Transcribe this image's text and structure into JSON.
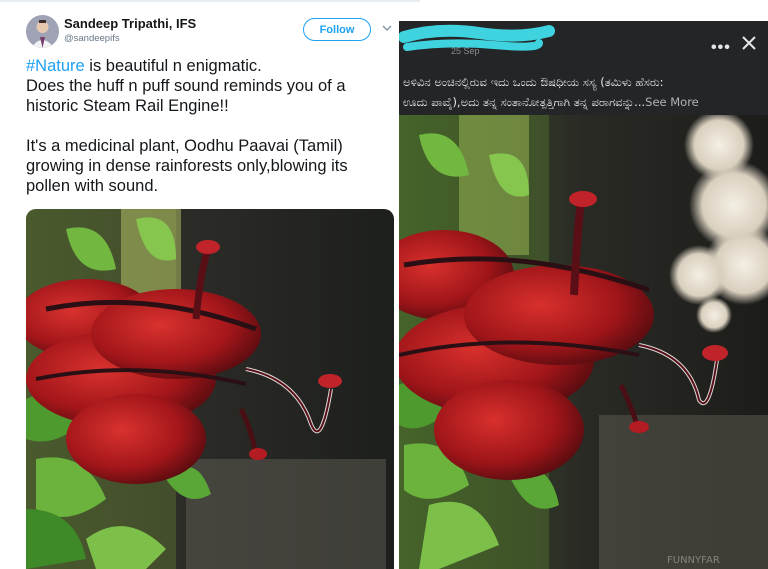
{
  "tweet": {
    "author_name": "Sandeep Tripathi, IFS",
    "author_handle": "@sandeepifs",
    "follow_label": "Follow",
    "hashtag": "#Nature",
    "line1_rest": " is beautiful n enigmatic.",
    "line2": "Does  the huff n puff sound reminds you of a",
    "line3": "historic Steam Rail Engine!!",
    "line4": "It's a medicinal plant, Oodhu Paavai (Tamil)",
    "line5": "growing in dense rainforests only,blowing its",
    "line6": "pollen with sound.",
    "image_alt": "Red flower plant with spout-like tip in a rainforest"
  },
  "post": {
    "date": "25 Sep",
    "caption_line1": "ಅಳಿವಿನ ಅಂಚಿನಲ್ಲಿರುವ ಇದು ಒಂದು ಔಷಧೀಯ ಸಸ್ಯ (ತಮಿಳು ಹೆಸರು:",
    "caption_line2": "ಊದು ಪಾವೈ),ಅದು ತನ್ನ ಸಂತಾನೋತ್ಪತ್ತಿಗಾಗಿ ತನ್ನ ಪರಾಗವನ್ನು...",
    "see_more": "See More",
    "more_icon": "•••",
    "watermark": "FUNNYFAR",
    "image_alt": "Red flower plant releasing smoke-like cloud"
  },
  "colors": {
    "twitter_blue": "#1da1f2",
    "post_header_bg": "#242526",
    "redaction": "#3fd3e0"
  }
}
